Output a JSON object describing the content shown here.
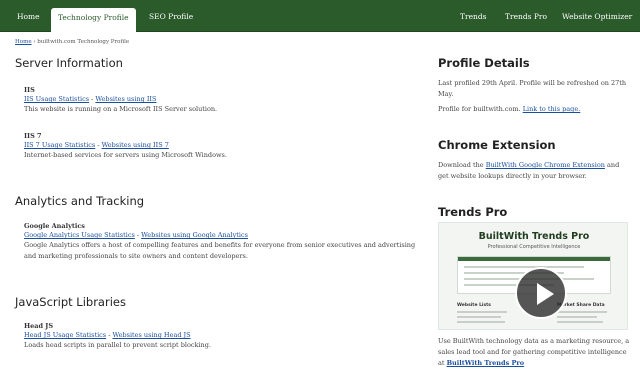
{
  "nav": {
    "tabs": [
      "Home",
      "Technology Profile",
      "SEO Profile"
    ],
    "right_tabs": [
      "Trends",
      "Trends Pro",
      "Website Optimizer"
    ]
  },
  "breadcrumb": {
    "home": "Home",
    "rest": "› builtwith.com Technology Profile"
  },
  "left": {
    "server": {
      "heading": "Server Information",
      "items": [
        {
          "name": "IIS",
          "link1": "IIS Usage Statistics",
          "sep": " - ",
          "link2": "Websites using IIS",
          "desc": "This website is running on a Microsoft IIS Server solution."
        },
        {
          "name": "IIS 7",
          "link1": "IIS 7 Usage Statistics",
          "sep": " - ",
          "link2": "Websites using IIS 7",
          "desc": "Internet-based services for servers using Microsoft Windows."
        }
      ]
    },
    "analytics": {
      "heading": "Analytics and Tracking",
      "items": [
        {
          "name": "Google Analytics",
          "link1": "Google Analytics Usage Statistics",
          "sep": " - ",
          "link2": "Websites using Google Analytics",
          "desc": "Google Analytics offers a host of compelling features and benefits for everyone from senior executives and advertising and marketing professionals to site owners and content developers."
        }
      ]
    },
    "js": {
      "heading": "JavaScript Libraries",
      "items": [
        {
          "name": "Head JS",
          "link1": "Head JS Usage Statistics",
          "sep": " - ",
          "link2": "Websites using Head JS",
          "desc": "Loads head scripts in parallel to prevent script blocking."
        }
      ]
    }
  },
  "right": {
    "profile": {
      "heading": "Profile Details",
      "line1": "Last profiled 29th April. Profile will be refreshed on 27th May.",
      "line2_pre": "Profile for builtwith.com. ",
      "line2_link": "Link to this page."
    },
    "chrome": {
      "heading": "Chrome Extension",
      "pre": "Download the ",
      "link": "BuiltWith Google Chrome Extension",
      "post": " and get website lookups directly in your browser."
    },
    "trends": {
      "heading": "Trends Pro",
      "promo_title": "BuiltWith Trends Pro",
      "promo_sub": "Professional Competitive Intelligence",
      "col1": "Website Lists",
      "col2": "Market Share Data",
      "text_pre": "Use BuiltWith technology data as a marketing resource, a sales lead tool and for gathering competitive intelligence at ",
      "text_link": "BuiltWith Trends Pro"
    }
  },
  "colors": {
    "nav_bg": "#2b5a2b",
    "link": "#1a4fa0"
  },
  "icons": [
    "play-icon"
  ]
}
